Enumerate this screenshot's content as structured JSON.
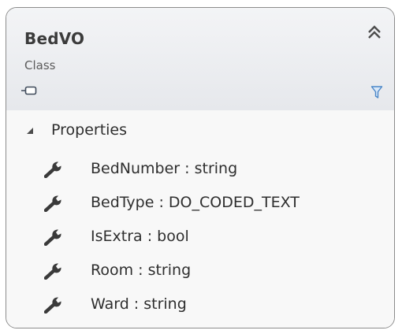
{
  "class_shape": {
    "name": "BedVO",
    "stereotype": "Class",
    "collapse_icon": "double-chevron-up-icon",
    "class_icon": "class-shape-icon",
    "filter_icon": "filter-icon"
  },
  "section": {
    "label": "Properties",
    "expander_icon": "triangle-expanded-icon",
    "property_icon": "wrench-icon",
    "items": [
      {
        "label": "BedNumber : string"
      },
      {
        "label": "BedType : DO_CODED_TEXT"
      },
      {
        "label": "IsExtra : bool"
      },
      {
        "label": "Room : string"
      },
      {
        "label": "Ward : string"
      }
    ]
  },
  "colors": {
    "border": "#8c8c8c",
    "header_bg": "#e6e8ec",
    "filter_icon": "#4a86c8",
    "text": "#2e2e2e"
  }
}
